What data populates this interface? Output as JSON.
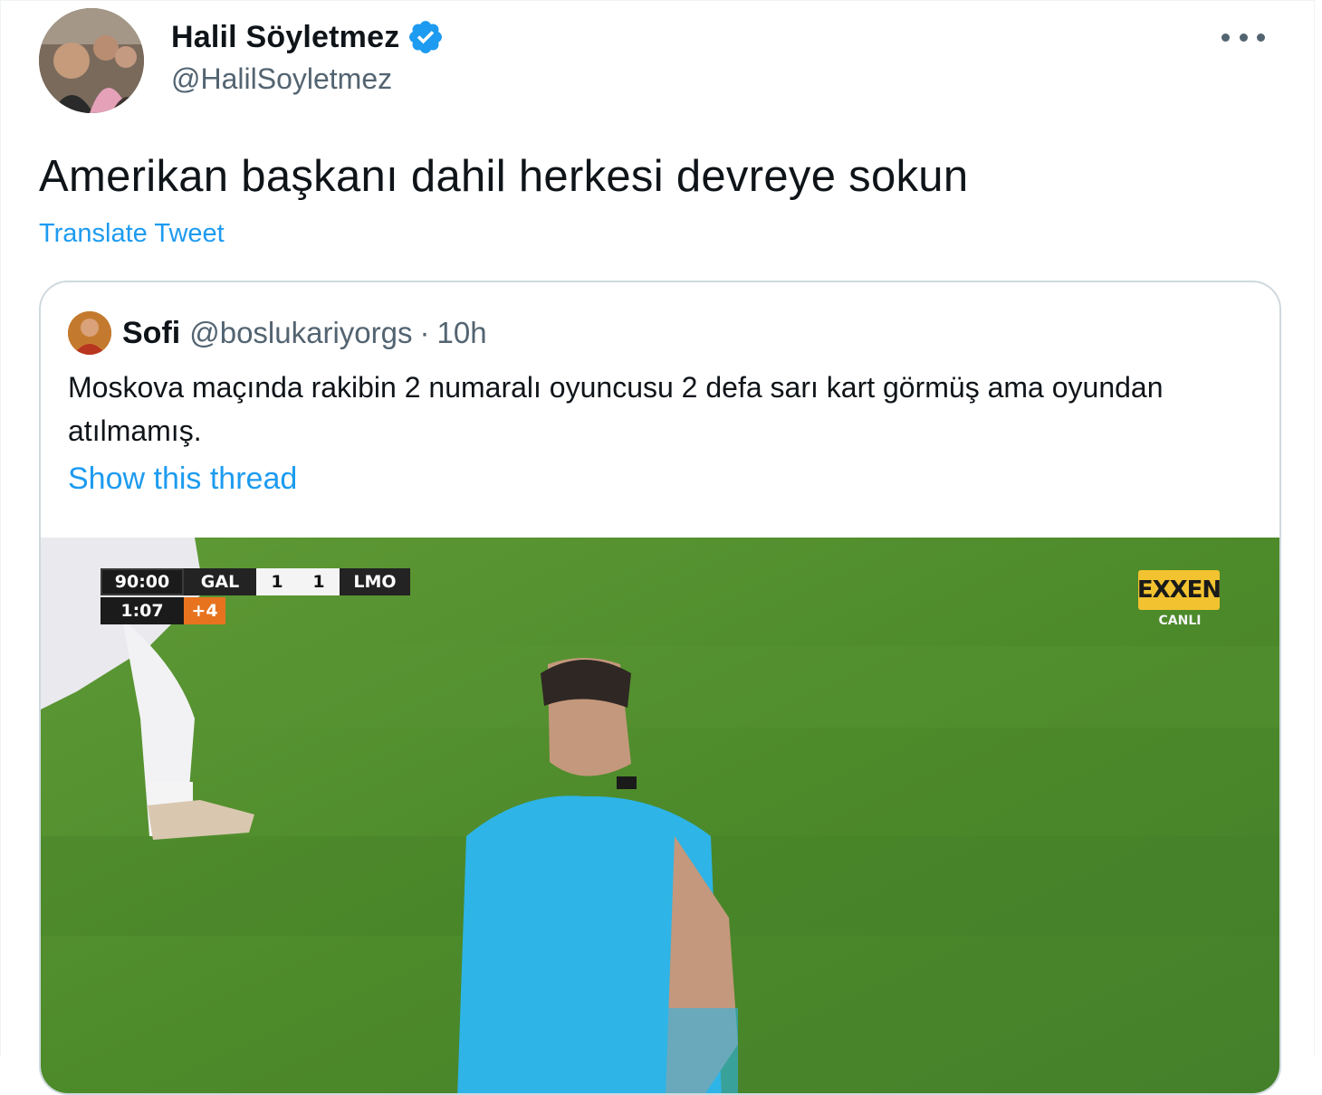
{
  "author": {
    "display_name": "Halil Söyletmez",
    "handle": "@HalilSoyletmez",
    "verified": true
  },
  "tweet": {
    "text": "Amerikan başkanı dahil herkesi devreye sokun",
    "translate_label": "Translate Tweet"
  },
  "quoted_tweet": {
    "display_name": "Sofi",
    "handle": "@boslukariyorgs",
    "separator": "·",
    "time": "10h",
    "text": "Moskova maçında rakibin 2 numaralı oyuncusu 2 defa sarı kart görmüş ama oyundan atılmamış.",
    "show_thread_label": "Show this thread"
  },
  "video_overlay": {
    "match_clock": "90:00",
    "home_team": "GAL",
    "home_score": "1",
    "away_score": "1",
    "away_team": "LMO",
    "extra_clock": "1:07",
    "added_time": "+4",
    "broadcaster_logo": "EXXEN",
    "live_label": "CANLI"
  },
  "icons": {
    "verified": "verified-badge-icon",
    "more": "more-options-icon"
  },
  "colors": {
    "link": "#1d9bf0",
    "secondary_text": "#536471",
    "pitch_green": "#4f8a2c",
    "referee_shirt": "#2eb4e6"
  }
}
